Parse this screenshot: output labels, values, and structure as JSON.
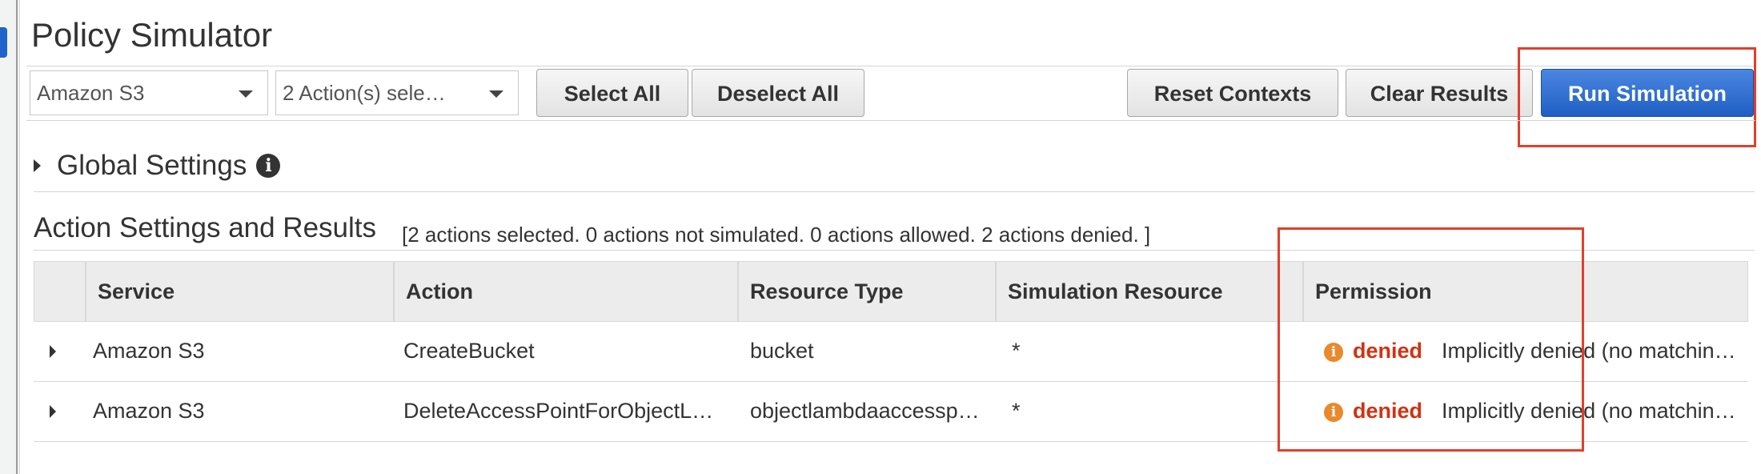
{
  "page": {
    "title": "Policy Simulator"
  },
  "toolbar": {
    "service_select": "Amazon S3",
    "action_select": "2 Action(s) sele…",
    "select_all": "Select All",
    "deselect_all": "Deselect All",
    "reset_contexts": "Reset Contexts",
    "clear_results": "Clear Results",
    "run_simulation": "Run Simulation"
  },
  "global_settings": {
    "label": "Global Settings",
    "info": "i"
  },
  "results": {
    "title": "Action Settings and Results",
    "summary": "[2 actions selected. 0 actions not simulated. 0 actions allowed. 2 actions denied. ]",
    "columns": [
      "Service",
      "Action",
      "Resource Type",
      "Simulation Resource",
      "Permission"
    ],
    "rows": [
      {
        "service": "Amazon S3",
        "action": "CreateBucket",
        "resource_type": "bucket",
        "simulation_resource": "*",
        "permission": "denied",
        "detail": "Implicitly denied (no matchin…"
      },
      {
        "service": "Amazon S3",
        "action": "DeleteAccessPointForObjectL…",
        "resource_type": "objectlambdaaccessp…",
        "simulation_resource": "*",
        "permission": "denied",
        "detail": "Implicitly denied (no matchin…"
      }
    ]
  },
  "colors": {
    "accent": "#1f5fc4",
    "denied": "#d13212",
    "warning_icon": "#e8892b",
    "highlight": "#e0402b"
  },
  "icons": {
    "info": "info-icon",
    "denied": "warning-info-icon"
  }
}
